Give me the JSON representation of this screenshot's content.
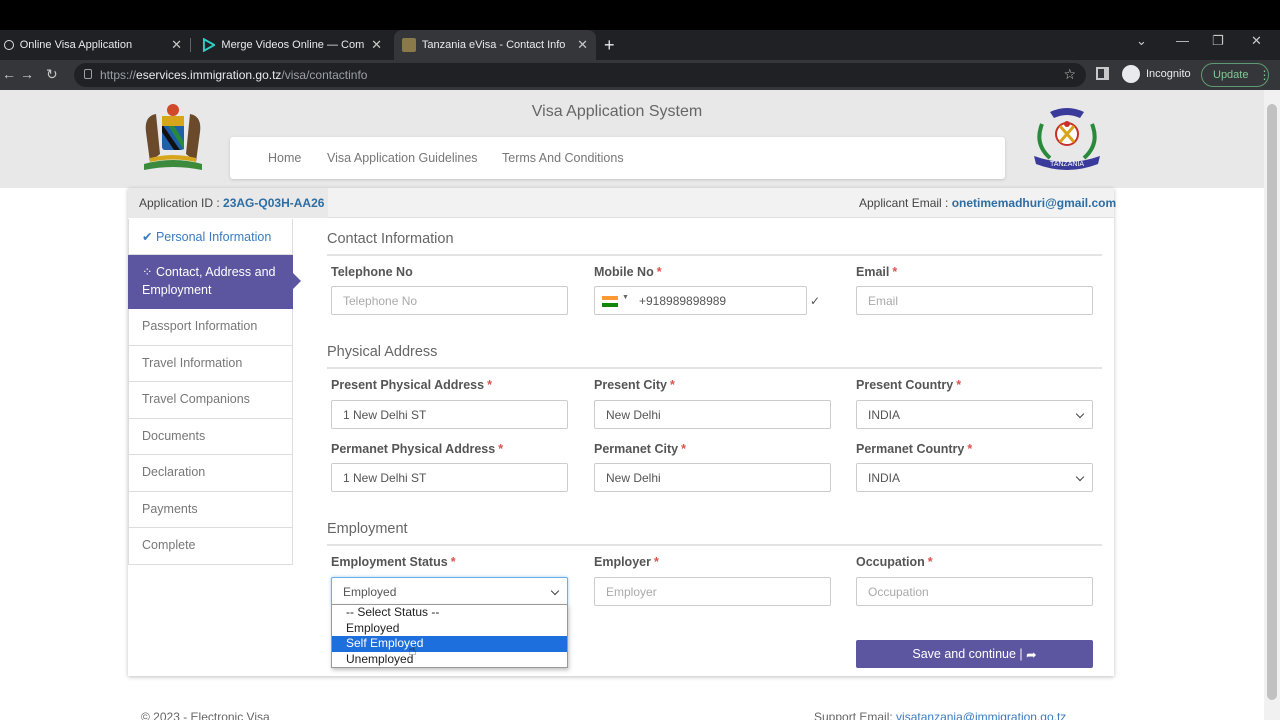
{
  "browser": {
    "tabs": [
      {
        "title": "Online Visa Application"
      },
      {
        "title": "Merge Videos Online — Combine"
      },
      {
        "title": "Tanzania eVisa - Contact Info"
      }
    ],
    "url_prefix": "https://",
    "url_host": "eservices.immigration.go.tz",
    "url_path": "/visa/contactinfo",
    "incognito_label": "Incognito",
    "update_label": "Update"
  },
  "header": {
    "system_title": "Visa Application System",
    "nav": [
      "Home",
      "Visa Application Guidelines",
      "Terms And Conditions"
    ],
    "logo_text": "TANZANIA"
  },
  "app": {
    "id_label": "Application ID : ",
    "id_value": "23AG-Q03H-AA26",
    "email_label": "Applicant Email : ",
    "email_value": "onetimemadhuri@gmail.com"
  },
  "sidenav": [
    {
      "label": "Personal Information",
      "icon": "check-icon",
      "state": "done"
    },
    {
      "label": "Contact, Address and Employment",
      "icon": "spinner-icon",
      "state": "active"
    },
    {
      "label": "Passport Information"
    },
    {
      "label": "Travel Information"
    },
    {
      "label": "Travel Companions"
    },
    {
      "label": "Documents"
    },
    {
      "label": "Declaration"
    },
    {
      "label": "Payments"
    },
    {
      "label": "Complete"
    }
  ],
  "sections": {
    "contact": "Contact Information",
    "address": "Physical Address",
    "employment": "Employment"
  },
  "fields": {
    "telephone": {
      "label": "Telephone No",
      "placeholder": "Telephone No",
      "required": false
    },
    "mobile": {
      "label": "Mobile No",
      "value": "+918989898989",
      "required": true
    },
    "email": {
      "label": "Email",
      "placeholder": "Email",
      "required": true
    },
    "present_address": {
      "label": "Present Physical Address",
      "value": "1 New Delhi ST",
      "required": true
    },
    "present_city": {
      "label": "Present City",
      "value": "New Delhi",
      "required": true
    },
    "present_country": {
      "label": "Present Country",
      "value": "INDIA",
      "required": true
    },
    "perm_address": {
      "label": "Permanet Physical Address",
      "value": "1 New Delhi ST",
      "required": true
    },
    "perm_city": {
      "label": "Permanet City",
      "value": "New Delhi",
      "required": true
    },
    "perm_country": {
      "label": "Permanet Country",
      "value": "INDIA",
      "required": true
    },
    "emp_status": {
      "label": "Employment Status",
      "value": "Employed",
      "required": true
    },
    "employer": {
      "label": "Employer",
      "placeholder": "Employer",
      "required": true
    },
    "occupation": {
      "label": "Occupation",
      "placeholder": "Occupation",
      "required": true
    }
  },
  "req_mark": "*",
  "validated_mark": "✓",
  "emp_status_options": [
    "-- Select Status --",
    "Employed",
    "Self Employed",
    "Unemployed"
  ],
  "emp_status_highlighted": "Self Employed",
  "save_button": "Save and continue |",
  "footer": {
    "left": "© 2023 - Electronic Visa",
    "right_label": "Support Email: ",
    "right_email": "visatanzania@immigration.go.tz"
  },
  "colors": {
    "accent": "#5c559f",
    "link": "#2d6da3",
    "required": "#d9534f"
  }
}
